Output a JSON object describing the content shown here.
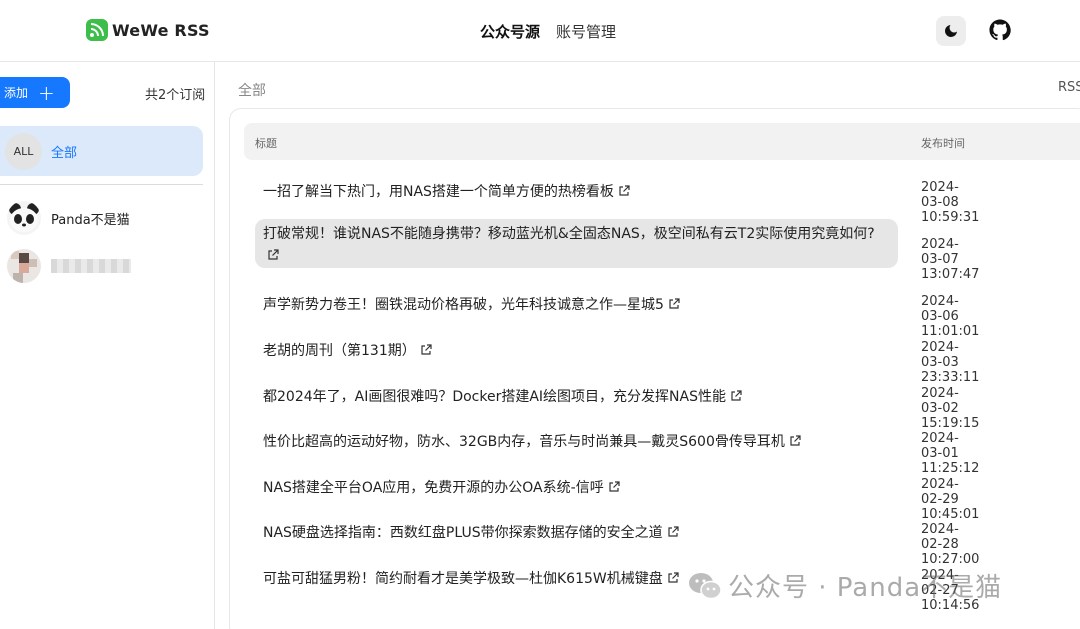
{
  "app": {
    "name": "WeWe RSS",
    "brand_color": "#3dbd4a",
    "accent_color": "#1677ff"
  },
  "nav": {
    "items": [
      {
        "label": "公众号源",
        "active": true
      },
      {
        "label": "账号管理",
        "active": false
      }
    ]
  },
  "header_icons": [
    "moon-icon",
    "github-icon"
  ],
  "sidebar": {
    "add_label": "添加",
    "sub_count": "共2个订阅",
    "all": {
      "avatar": "ALL",
      "label": "全部"
    },
    "feeds": [
      {
        "name": "Panda不是猫"
      },
      {
        "name": ""
      }
    ]
  },
  "main": {
    "breadcrumb": "全部",
    "rss_label": "RSS",
    "columns": {
      "title": "标题",
      "time": "发布时间"
    },
    "rows": [
      {
        "title": "一招了解当下热门，用NAS搭建一个简单方便的热榜看板",
        "time": "2024-03-08 10:59:31"
      },
      {
        "title": "打破常规！谁说NAS不能随身携带？移动蓝光机&全固态NAS，极空间私有云T2实际使用究竟如何?",
        "time": "2024-03-07 13:07:47",
        "hover": true
      },
      {
        "title": "声学新势力卷王！圈铁混动价格再破，光年科技诚意之作—星城5",
        "time": "2024-03-06 11:01:01"
      },
      {
        "title": "老胡的周刊（第131期）",
        "time": "2024-03-03 23:33:11"
      },
      {
        "title": "都2024年了，AI画图很难吗？Docker搭建AI绘图项目，充分发挥NAS性能",
        "time": "2024-03-02 15:19:15"
      },
      {
        "title": "性价比超高的运动好物，防水、32GB内存，音乐与时尚兼具—戴灵S600骨传导耳机",
        "time": "2024-03-01 11:25:12"
      },
      {
        "title": "NAS搭建全平台OA应用，免费开源的办公OA系统-信呼",
        "time": "2024-02-29 10:45:01"
      },
      {
        "title": "NAS硬盘选择指南：西数红盘PLUS带你探索数据存储的安全之道",
        "time": "2024-02-28 10:27:00"
      },
      {
        "title": "可盐可甜猛男粉！简约耐看才是美学极致—杜伽K615W机械键盘",
        "time": "2024-02-27 10:14:56"
      }
    ]
  },
  "watermark": {
    "text": "公众号 · Panda不是猫"
  }
}
